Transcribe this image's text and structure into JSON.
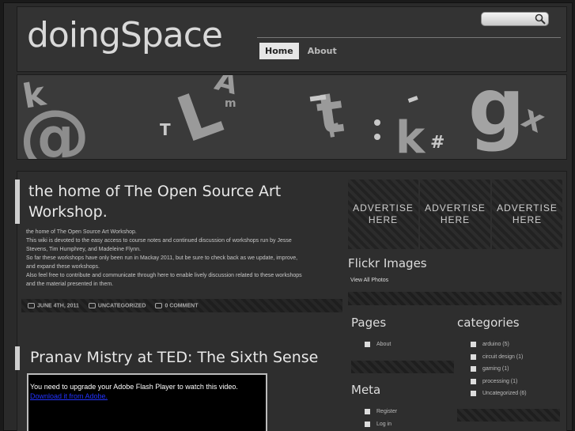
{
  "site": {
    "logo": "doingSpace"
  },
  "search": {
    "placeholder": ""
  },
  "nav": {
    "items": [
      {
        "label": "Home"
      },
      {
        "label": "About"
      }
    ]
  },
  "banner": {
    "letters": [
      "k",
      "@",
      "L",
      "A",
      "m",
      "t",
      "r",
      "k",
      "#",
      "g",
      "x",
      "T"
    ]
  },
  "post1": {
    "title": "the home of The Open Source Art Workshop.",
    "lines": [
      "the home of The Open Source Art Workshop.",
      "This wiki is devoted to the easy access to course notes and continued discussion of workshops run by Jesse",
      "Stevens, Tim Humphrey, and Madeleine Flynn.",
      "So far these workshops have only been run in Mackay 2011, but be sure to check back as we update, improve,",
      "and expand these workshops.",
      "Also feel free to contribute and communicate through here to enable lively discussion related to these workshops",
      "and the material presented in them."
    ],
    "date": "JUNE 4TH, 2011",
    "category": "UNCATEGORIZED",
    "comments": "0 COMMENT"
  },
  "post2": {
    "title": "Pranav Mistry at TED: The Sixth Sense",
    "flash_message": "You need to upgrade your Adobe Flash Player to watch this video.",
    "flash_link": "Download it from Adobe."
  },
  "ads": [
    {
      "line1": "ADVERTISE",
      "line2": "HERE"
    },
    {
      "line1": "ADVERTISE",
      "line2": "HERE"
    },
    {
      "line1": "ADVERTISE",
      "line2": "HERE"
    }
  ],
  "flickr": {
    "title": "Flickr Images",
    "link": "View All Photos"
  },
  "pages": {
    "title": "Pages",
    "items": [
      "About"
    ]
  },
  "categories": {
    "title": "categories",
    "items": [
      "arduino (5)",
      "circuit design (1)",
      "gaming (1)",
      "processing (1)",
      "Uncategorized (6)"
    ]
  },
  "meta": {
    "title": "Meta",
    "items": [
      "Register",
      "Log in"
    ]
  },
  "colors": {
    "background": "#2a2a2a",
    "accent": "#d0d0d0",
    "link": "#2233ff"
  }
}
